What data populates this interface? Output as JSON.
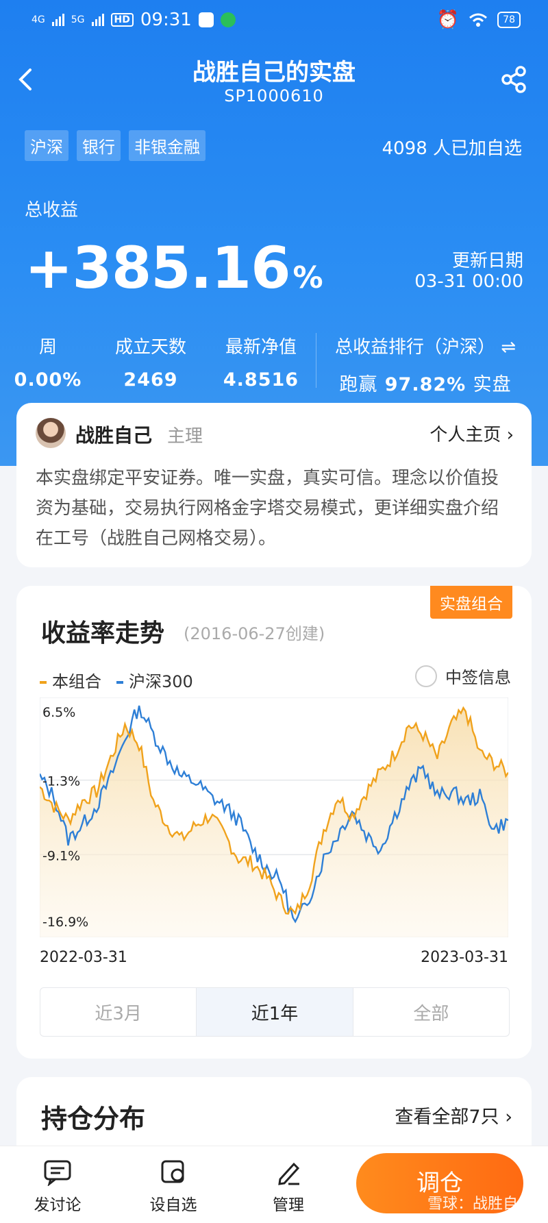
{
  "status_bar": {
    "time": "09:31",
    "net1": "4G",
    "net2": "5G",
    "hd": "HD",
    "battery": "78"
  },
  "header": {
    "title": "战胜自己的实盘",
    "code": "SP1000610"
  },
  "tags": [
    "沪深",
    "银行",
    "非银金融"
  ],
  "followers": "4098 人已加自选",
  "summary": {
    "total_label": "总收益",
    "total_value": "+385.16",
    "total_unit": "%",
    "update_label": "更新日期",
    "update_value": "03-31 00:00"
  },
  "stats": [
    {
      "label": "周",
      "value": "0.00%"
    },
    {
      "label": "成立天数",
      "value": "2469"
    },
    {
      "label": "最新净值",
      "value": "4.8516"
    }
  ],
  "rank": {
    "label": "总收益排行（沪深）",
    "prefix": "跑赢",
    "value": "97.82%",
    "suffix": "实盘"
  },
  "manager": {
    "name": "战胜自己",
    "role": "主理",
    "homepage": "个人主页",
    "description": "本实盘绑定平安证券。唯一实盘，真实可信。理念以价值投资为基础，交易执行网格金字塔交易模式，更详细实盘介绍在工号（战胜自己网格交易）。"
  },
  "chart_section": {
    "badge": "实盘组合",
    "title": "收益率走势",
    "created": "(2016-06-27创建)",
    "signal_info": "中签信息",
    "x_start": "2022-03-31",
    "x_end": "2023-03-31",
    "ranges": [
      "近3月",
      "近1年",
      "全部"
    ],
    "active_range": "近1年",
    "colors": {
      "portfolio": "#f0a21c",
      "index": "#2e7fd6"
    }
  },
  "chart_data": {
    "type": "line",
    "ytick_labels": [
      "6.5%",
      "-1.3%",
      "-9.1%",
      "-16.9%"
    ],
    "ylim": [
      -16.9,
      6.5
    ],
    "x_labels": [
      "2022-03-31",
      "2023-03-31"
    ],
    "series": [
      {
        "name": "本组合",
        "values": [
          -2.0,
          -4.0,
          -5.5,
          -3.5,
          -2.5,
          1.0,
          4.5,
          2.5,
          -3.5,
          -6.0,
          -7.5,
          -6.0,
          -5.0,
          -7.0,
          -9.5,
          -10.0,
          -11.5,
          -14.0,
          -15.5,
          -12.0,
          -6.5,
          -3.0,
          -5.0,
          -2.5,
          -0.5,
          1.5,
          4.5,
          3.5,
          1.0,
          4.5,
          6.0,
          1.5,
          0.5,
          -0.5
        ]
      },
      {
        "name": "沪深300",
        "values": [
          -1.0,
          -3.0,
          -7.5,
          -6.0,
          -4.0,
          -1.0,
          3.0,
          6.5,
          3.5,
          1.0,
          -1.0,
          -1.5,
          -3.0,
          -4.0,
          -5.5,
          -8.5,
          -10.5,
          -12.0,
          -16.5,
          -13.5,
          -9.5,
          -7.0,
          -4.5,
          -7.0,
          -8.5,
          -5.0,
          -2.0,
          0.0,
          -3.0,
          -2.5,
          -3.5,
          -3.0,
          -6.5,
          -5.5
        ]
      }
    ]
  },
  "holdings": {
    "title": "持仓分布",
    "more": "查看全部7只"
  },
  "bottom_bar": {
    "discuss": "发讨论",
    "watch": "设自选",
    "manage": "管理",
    "trade": "调仓",
    "watermark": "雪球：战胜自己"
  }
}
